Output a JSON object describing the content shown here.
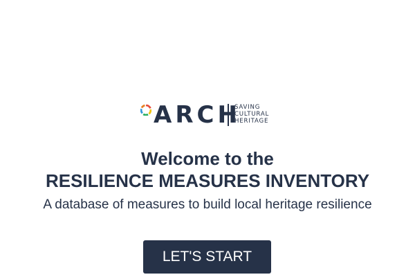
{
  "logo": {
    "wordmark": "ARCH",
    "tagline": [
      "SAVING",
      "CULTURAL",
      "HERITAGE"
    ],
    "icon": "arch-logo-ring-icon",
    "ring_colors": [
      "#e74c3c",
      "#f1c40f",
      "#27ae60",
      "#3498db",
      "#e67e22"
    ]
  },
  "welcome": {
    "line1": "Welcome to the",
    "line2": "RESILIENCE MEASURES INVENTORY",
    "subtitle": "A database of measures to build local heritage resilience"
  },
  "start_button": {
    "label": "LET'S START"
  },
  "colors": {
    "primary": "#263248",
    "background": "#ffffff",
    "button_text": "#ffffff"
  }
}
